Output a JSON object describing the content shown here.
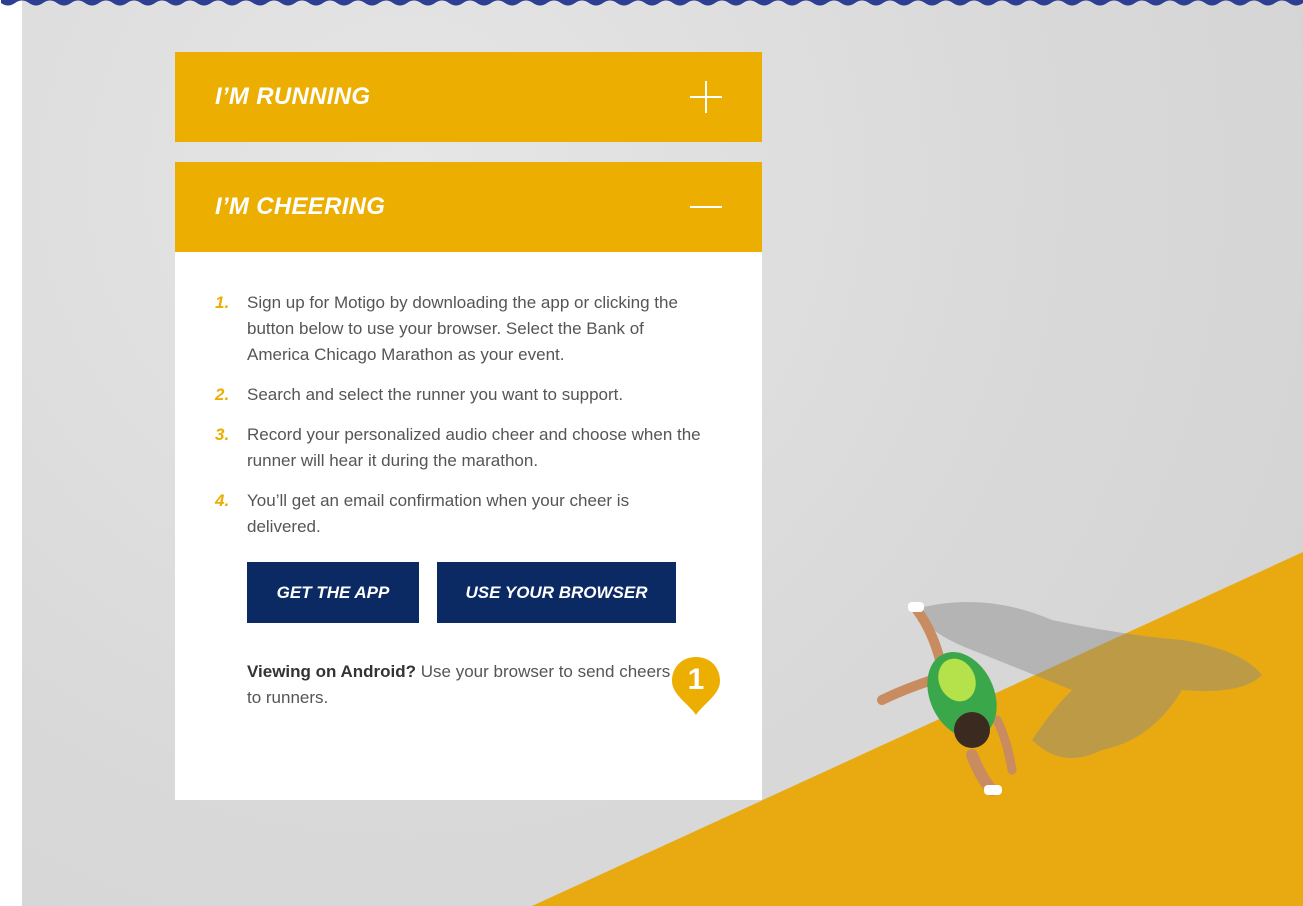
{
  "accordion": {
    "running": {
      "title": "I’M RUNNING",
      "icon": "plus-icon"
    },
    "cheering": {
      "title": "I’M CHEERING",
      "icon": "minus-icon",
      "steps": [
        {
          "num": "1.",
          "text": "Sign up for Motigo by downloading the app or clicking the button below to use your browser. Select the Bank of America Chicago Marathon as your event."
        },
        {
          "num": "2.",
          "text": "Search and select the runner you want to support."
        },
        {
          "num": "3.",
          "text": "Record your personalized audio cheer and choose when the runner will hear it during the marathon."
        },
        {
          "num": "4.",
          "text": "You’ll get an email confirmation when your cheer is delivered."
        }
      ],
      "buttons": {
        "app": "GET THE APP",
        "browser": "USE YOUR BROWSER"
      },
      "android": {
        "strong": "Viewing on Android?",
        "rest": " Use your browser to send cheers to runners."
      }
    }
  },
  "marker": {
    "label": "1",
    "icon": "map-pin-icon"
  },
  "colors": {
    "accent": "#ecae00",
    "navy": "#0b2a63",
    "text": "#555555"
  }
}
